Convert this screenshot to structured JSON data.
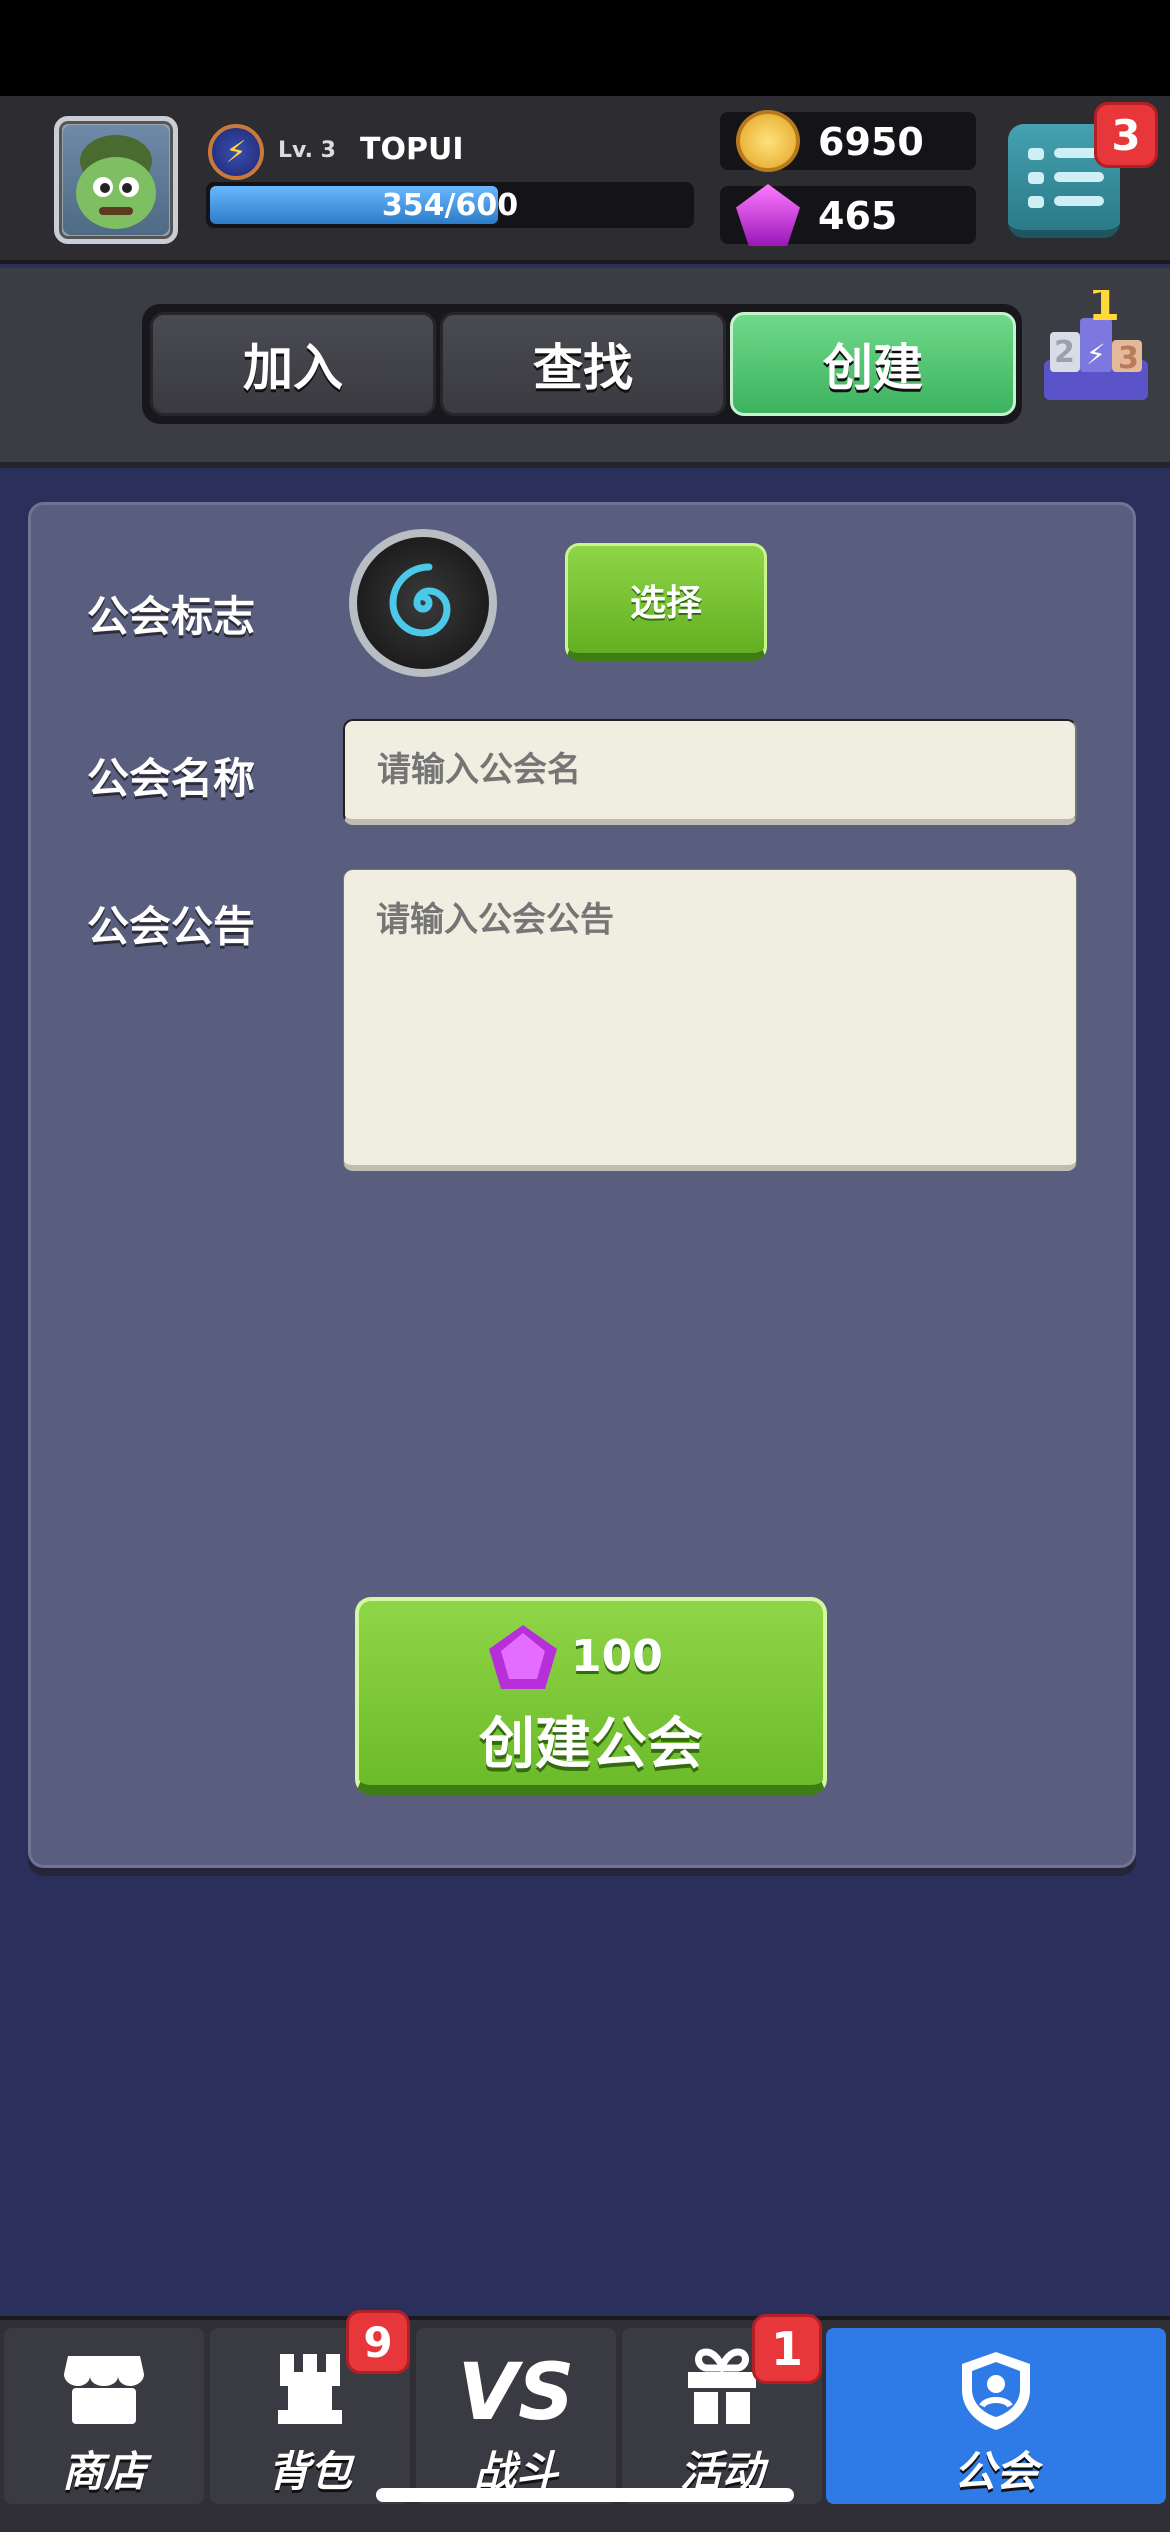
{
  "player": {
    "level": "Lv. 3",
    "name": "TOPUI",
    "xp_text": "354/600",
    "xp_progress": 0.59
  },
  "currency": {
    "coins": "6950",
    "gems": "465"
  },
  "menu": {
    "badge": "3"
  },
  "tabs": [
    {
      "label": "加入",
      "active": false
    },
    {
      "label": "查找",
      "active": false
    },
    {
      "label": "创建",
      "active": true
    }
  ],
  "form": {
    "emblem_label": "公会标志",
    "select_label": "选择",
    "name_label": "公会名称",
    "name_placeholder": "请输入公会名",
    "notice_label": "公会公告",
    "notice_placeholder": "请输入公会公告",
    "create_cost": "100",
    "create_label": "创建公会"
  },
  "nav": [
    {
      "label": "商店",
      "icon": "shop-icon",
      "badge": ""
    },
    {
      "label": "背包",
      "icon": "backpack-icon",
      "badge": "9"
    },
    {
      "label": "战斗",
      "icon": "vs-icon",
      "badge": ""
    },
    {
      "label": "活动",
      "icon": "gift-icon",
      "badge": "1"
    },
    {
      "label": "公会",
      "icon": "guild-shield-icon",
      "badge": ""
    }
  ],
  "colors": {
    "active_tab": "#3cb25f",
    "active_nav": "#2e7be8",
    "create_button": "#6cbb2a",
    "badge": "#e8373a"
  }
}
